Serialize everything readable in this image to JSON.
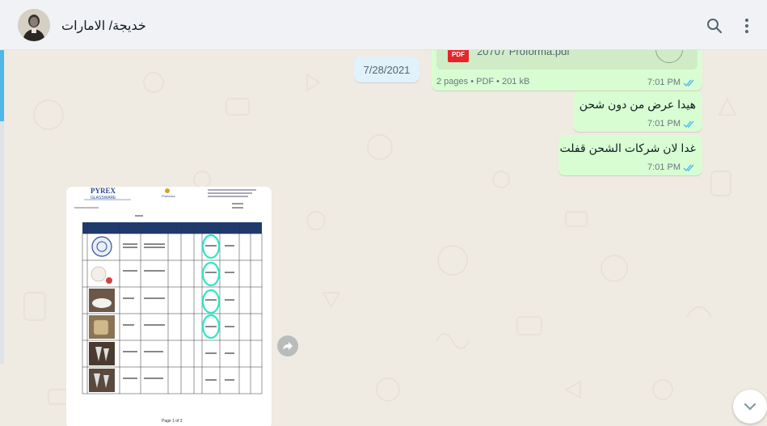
{
  "header": {
    "contact_name": "خديجة/ الامارات",
    "avatar_icon": "contact-photo",
    "search_icon": "search-icon",
    "menu_icon": "kebab-menu-icon"
  },
  "chat": {
    "date_chip": "7/28/2021",
    "pdf_message": {
      "file_icon_label": "PDF",
      "file_name": "20707 Proforma.pdf",
      "info": "2 pages • PDF • 201 kB",
      "time": "7:01 PM",
      "status": "read"
    },
    "messages": [
      {
        "text": "هيدا عرض من دون شحن",
        "time": "7:01 PM",
        "status": "read"
      },
      {
        "text": "غدا لان شركات الشحن قفلت",
        "time": "7:01 PM",
        "status": "read"
      }
    ],
    "image_message": {
      "doc_brand": "GLASSWARE",
      "doc_company": "Proforma",
      "doc_footer": "Page 1 of 3",
      "circle_color": "#2ee6c6"
    }
  },
  "colors": {
    "outgoing_bubble": "#d9fdd3",
    "chat_background": "#efeae2",
    "read_ticks": "#53bdeb",
    "date_chip": "#e1f2fb"
  }
}
